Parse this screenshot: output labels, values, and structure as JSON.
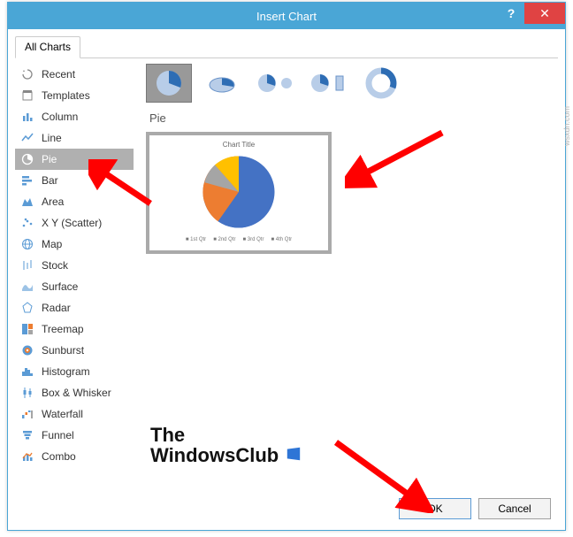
{
  "window": {
    "title": "Insert Chart",
    "help": "?",
    "close": "✕"
  },
  "tabs": {
    "all_charts": "All Charts"
  },
  "sidebar": {
    "items": [
      {
        "label": "Recent"
      },
      {
        "label": "Templates"
      },
      {
        "label": "Column"
      },
      {
        "label": "Line"
      },
      {
        "label": "Pie"
      },
      {
        "label": "Bar"
      },
      {
        "label": "Area"
      },
      {
        "label": "X Y (Scatter)"
      },
      {
        "label": "Map"
      },
      {
        "label": "Stock"
      },
      {
        "label": "Surface"
      },
      {
        "label": "Radar"
      },
      {
        "label": "Treemap"
      },
      {
        "label": "Sunburst"
      },
      {
        "label": "Histogram"
      },
      {
        "label": "Box & Whisker"
      },
      {
        "label": "Waterfall"
      },
      {
        "label": "Funnel"
      },
      {
        "label": "Combo"
      }
    ]
  },
  "main": {
    "section_label": "Pie",
    "preview_title": "Chart Title",
    "legend": [
      "1st Qtr",
      "2nd Qtr",
      "3rd Qtr",
      "4th Qtr"
    ]
  },
  "footer": {
    "ok": "OK",
    "cancel": "Cancel"
  },
  "watermark": {
    "line1": "The",
    "line2": "WindowsClub"
  },
  "source": "wsxdn.com",
  "chart_data": {
    "type": "pie",
    "title": "Chart Title",
    "categories": [
      "1st Qtr",
      "2nd Qtr",
      "3rd Qtr",
      "4th Qtr"
    ],
    "values": [
      58,
      23,
      10,
      9
    ],
    "colors": [
      "#4472c4",
      "#ed7d31",
      "#a5a5a5",
      "#ffc000"
    ]
  }
}
